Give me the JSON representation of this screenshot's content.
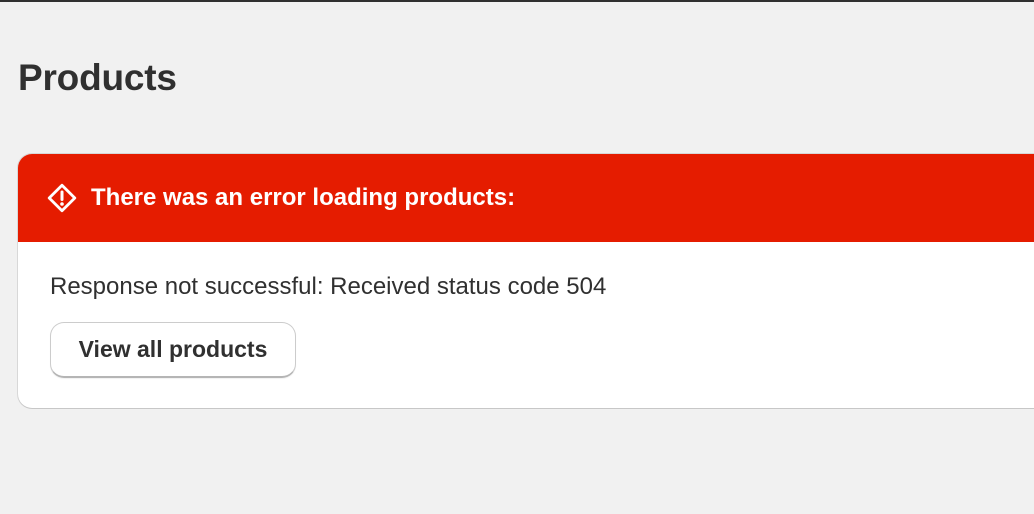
{
  "page": {
    "title": "Products"
  },
  "error_banner": {
    "icon": "alert-diamond-icon",
    "title": "There was an error loading products:",
    "message": "Response not successful: Received status code 504",
    "action_label": "View all products",
    "colors": {
      "critical": "#e51c00",
      "header_text": "#ffffff",
      "body_background": "#ffffff"
    }
  },
  "colors": {
    "page_background": "#f1f1f1",
    "text": "#303030"
  }
}
